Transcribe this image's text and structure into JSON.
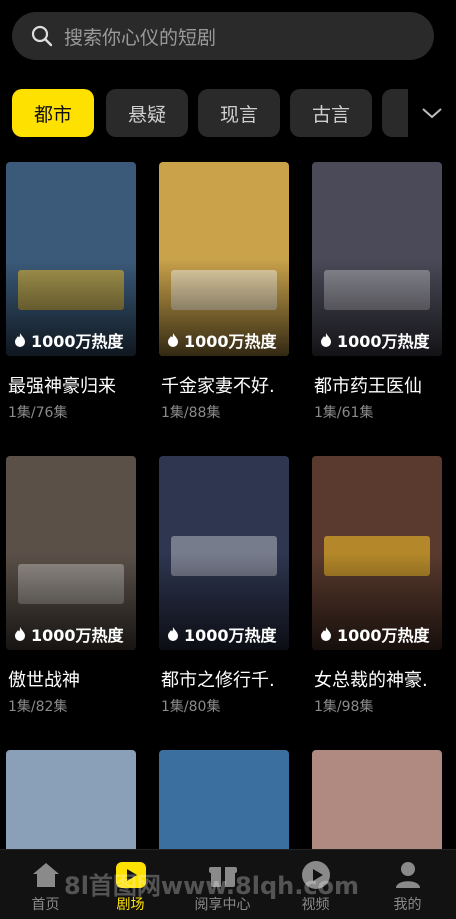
{
  "search": {
    "placeholder": "搜索你心仪的短剧"
  },
  "tabs": [
    {
      "label": "都市",
      "active": true
    },
    {
      "label": "悬疑",
      "active": false
    },
    {
      "label": "现言",
      "active": false
    },
    {
      "label": "古言",
      "active": false
    },
    {
      "label": "",
      "active": false
    }
  ],
  "dramas": [
    {
      "title": "最强神豪归来",
      "episodes": "1集/76集",
      "heat": "1000万热度",
      "color": "#3b5a7a"
    },
    {
      "title": "千金家妻不好.",
      "episodes": "1集/88集",
      "heat": "1000万热度",
      "color": "#c9a24a"
    },
    {
      "title": "都市药王医仙",
      "episodes": "1集/61集",
      "heat": "1000万热度",
      "color": "#4a4a58"
    },
    {
      "title": "傲世战神",
      "episodes": "1集/82集",
      "heat": "1000万热度",
      "color": "#5a5048"
    },
    {
      "title": "都市之修行千.",
      "episodes": "1集/80集",
      "heat": "1000万热度",
      "color": "#2e3650"
    },
    {
      "title": "女总裁的神豪.",
      "episodes": "1集/98集",
      "heat": "1000万热度",
      "color": "#5a3a2e"
    },
    {
      "title": "",
      "episodes": "",
      "heat": "",
      "color": "#8aa0b8"
    },
    {
      "title": "",
      "episodes": "",
      "heat": "",
      "color": "#3a6fa0"
    },
    {
      "title": "",
      "episodes": "",
      "heat": "",
      "color": "#b08a80"
    }
  ],
  "nav": [
    {
      "label": "首页",
      "icon": "home-icon",
      "active": false
    },
    {
      "label": "剧场",
      "icon": "play-square-icon",
      "active": true
    },
    {
      "label": "阅享中心",
      "icon": "gift-icon",
      "active": false
    },
    {
      "label": "视频",
      "icon": "play-circle-icon",
      "active": false
    },
    {
      "label": "我的",
      "icon": "person-icon",
      "active": false
    }
  ],
  "watermark": "8l首图网www.8lqh.com",
  "colors": {
    "accent": "#ffe100",
    "background": "#000000",
    "surface": "#2a2a2a"
  }
}
